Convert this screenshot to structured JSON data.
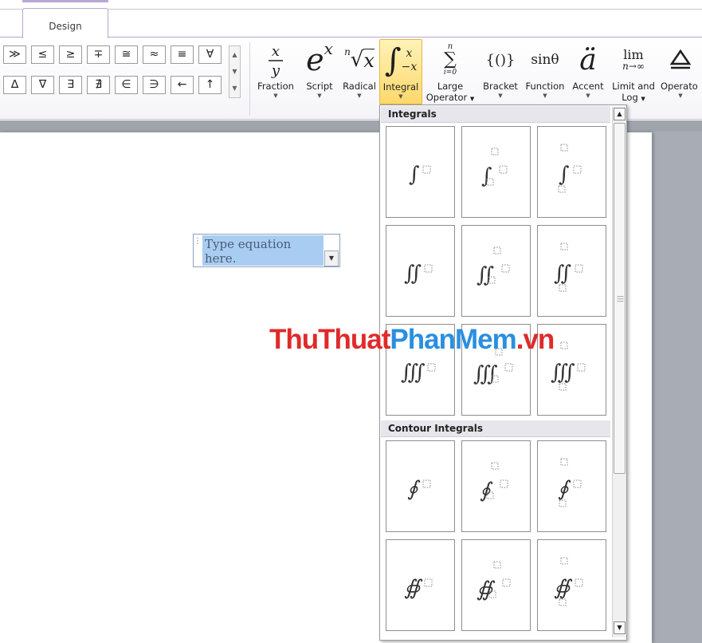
{
  "ribbon": {
    "active_tab": "Design",
    "symbols_row1": [
      "≫",
      "≤",
      "≥",
      "∓",
      "≅",
      "≈",
      "≡",
      "∀"
    ],
    "symbols_row2": [
      "∆",
      "∇",
      "∃",
      "∄",
      "∈",
      "∋",
      "←",
      "↑"
    ],
    "tools": [
      {
        "id": "fraction",
        "label": "Fraction",
        "label2": ""
      },
      {
        "id": "script",
        "label": "Script",
        "label2": ""
      },
      {
        "id": "radical",
        "label": "Radical",
        "label2": ""
      },
      {
        "id": "integral",
        "label": "Integral",
        "label2": ""
      },
      {
        "id": "large-operator",
        "label": "Large",
        "label2": "Operator"
      },
      {
        "id": "bracket",
        "label": "Bracket",
        "label2": ""
      },
      {
        "id": "function",
        "label": "Function",
        "label2": ""
      },
      {
        "id": "accent",
        "label": "Accent",
        "label2": ""
      },
      {
        "id": "limit-log",
        "label": "Limit and",
        "label2": "Log"
      },
      {
        "id": "operator",
        "label": "Operato",
        "label2": ""
      }
    ],
    "glyph_text": {
      "script_base": "e",
      "script_sup": "x",
      "radical_index": "n",
      "radical_arg": "x",
      "integral_upper": "x",
      "integral_lower": "−x",
      "largeop_upper": "n",
      "largeop_lower": "i=0",
      "bracket": "{()}",
      "function": "sinθ",
      "accent": "ä",
      "limit_top": "lim",
      "limit_bottom": "n→∞",
      "fraction_num": "x",
      "fraction_den": "y"
    }
  },
  "document": {
    "equation_placeholder": "Type equation here."
  },
  "gallery": {
    "section_integrals": "Integrals",
    "section_contour": "Contour Integrals"
  },
  "watermark": {
    "part1": "ThuThuat",
    "part2": "PhanMem",
    "part3": ".vn"
  }
}
